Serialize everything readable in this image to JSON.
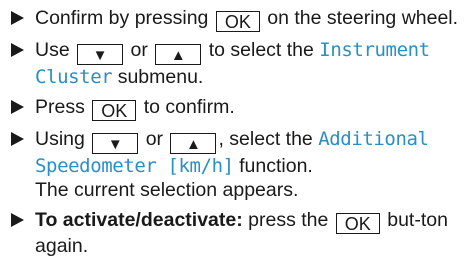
{
  "steps": [
    {
      "before": "Confirm by pressing",
      "key": "OK",
      "after": "on the steering wheel."
    },
    {
      "before": "Use",
      "key_down": "▼",
      "middle": "or",
      "key_up": "▲",
      "after": "to select the",
      "menu": "Instrument Cluster",
      "tail": "submenu."
    },
    {
      "before": "Press",
      "key": "OK",
      "after": "to confirm."
    },
    {
      "before": "Using",
      "key_down": "▼",
      "middle": "or",
      "key_up": "▲",
      "after": ", select the",
      "menu": "Additional Speedometer [km/h]",
      "tail": "function.",
      "note": "The current selection appears."
    },
    {
      "bold": "To activate/deactivate:",
      "before": "press the",
      "key": "OK",
      "after": "but-ton again."
    }
  ],
  "colors": {
    "menu_text": "#2a8fc4",
    "text": "#1a1a1a"
  }
}
